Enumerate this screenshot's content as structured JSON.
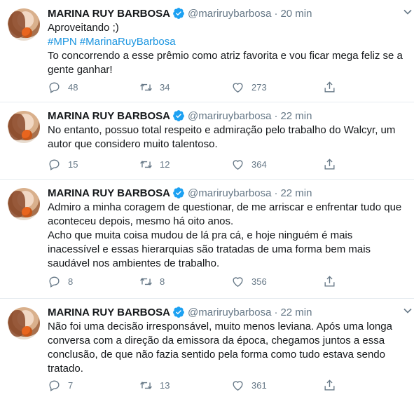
{
  "tweets": [
    {
      "name": "MARINA RUY BARBOSA",
      "handle": "@mariruybarbosa",
      "dot": "·",
      "time": "20 min",
      "lines": [
        "Aproveitando ;)"
      ],
      "hashtags": "#MPN #MarinaRuyBarbosa",
      "lines_after": [
        "To concorrendo a esse prêmio como atriz favorita e vou ficar mega feliz se a gente ganhar!"
      ],
      "replies": "48",
      "retweets": "34",
      "likes": "273"
    },
    {
      "name": "MARINA RUY BARBOSA",
      "handle": "@mariruybarbosa",
      "dot": "·",
      "time": "22 min",
      "lines": [
        "No entanto, possuo total respeito e admiração pelo trabalho do Walcyr, um autor que considero muito talentoso."
      ],
      "replies": "15",
      "retweets": "12",
      "likes": "364"
    },
    {
      "name": "MARINA RUY BARBOSA",
      "handle": "@mariruybarbosa",
      "dot": "·",
      "time": "22 min",
      "lines": [
        "Admiro a minha coragem de questionar, de me arriscar e enfrentar tudo que aconteceu depois, mesmo há oito anos.",
        "Acho que muita coisa mudou de lá pra cá, e hoje ninguém é mais inacessível e essas hierarquias são tratadas de uma forma bem mais saudável nos ambientes de trabalho."
      ],
      "replies": "8",
      "retweets": "8",
      "likes": "356"
    },
    {
      "name": "MARINA RUY BARBOSA",
      "handle": "@mariruybarbosa",
      "dot": "·",
      "time": "22 min",
      "lines": [
        "Não foi uma decisão irresponsável, muito menos leviana. Após uma longa conversa com a direção da emissora da época, chegamos juntos a essa conclusão, de que não fazia sentido pela forma como tudo estava sendo tratado."
      ],
      "replies": "7",
      "retweets": "13",
      "likes": "361"
    }
  ],
  "colors": {
    "accent": "#1da1f2",
    "hashtag": "#1b95e0",
    "muted": "#657786",
    "text": "#14171a",
    "border": "#e6ecf0"
  },
  "icons": {
    "reply": "reply-icon",
    "retweet": "retweet-icon",
    "like": "like-icon",
    "share": "share-icon",
    "verified": "verified-badge-icon",
    "menu": "chevron-down-icon"
  }
}
